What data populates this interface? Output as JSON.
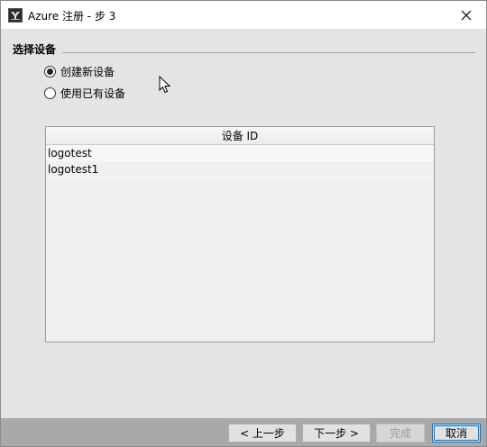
{
  "window": {
    "title": "Azure 注册 - 步 3",
    "close_glyph": "✕"
  },
  "section": {
    "title": "选择设备"
  },
  "options": [
    {
      "label": "创建新设备",
      "checked": true
    },
    {
      "label": "使用已有设备",
      "checked": false
    }
  ],
  "table": {
    "header": "设备 ID",
    "rows": [
      "logotest",
      "logotest1"
    ]
  },
  "buttons": {
    "back": "< 上一步",
    "next": "下一步 >",
    "finish": "完成",
    "cancel": "取消"
  },
  "icons": {
    "app": "app-icon",
    "close": "close-icon",
    "cursor": "mouse-cursor-icon"
  }
}
